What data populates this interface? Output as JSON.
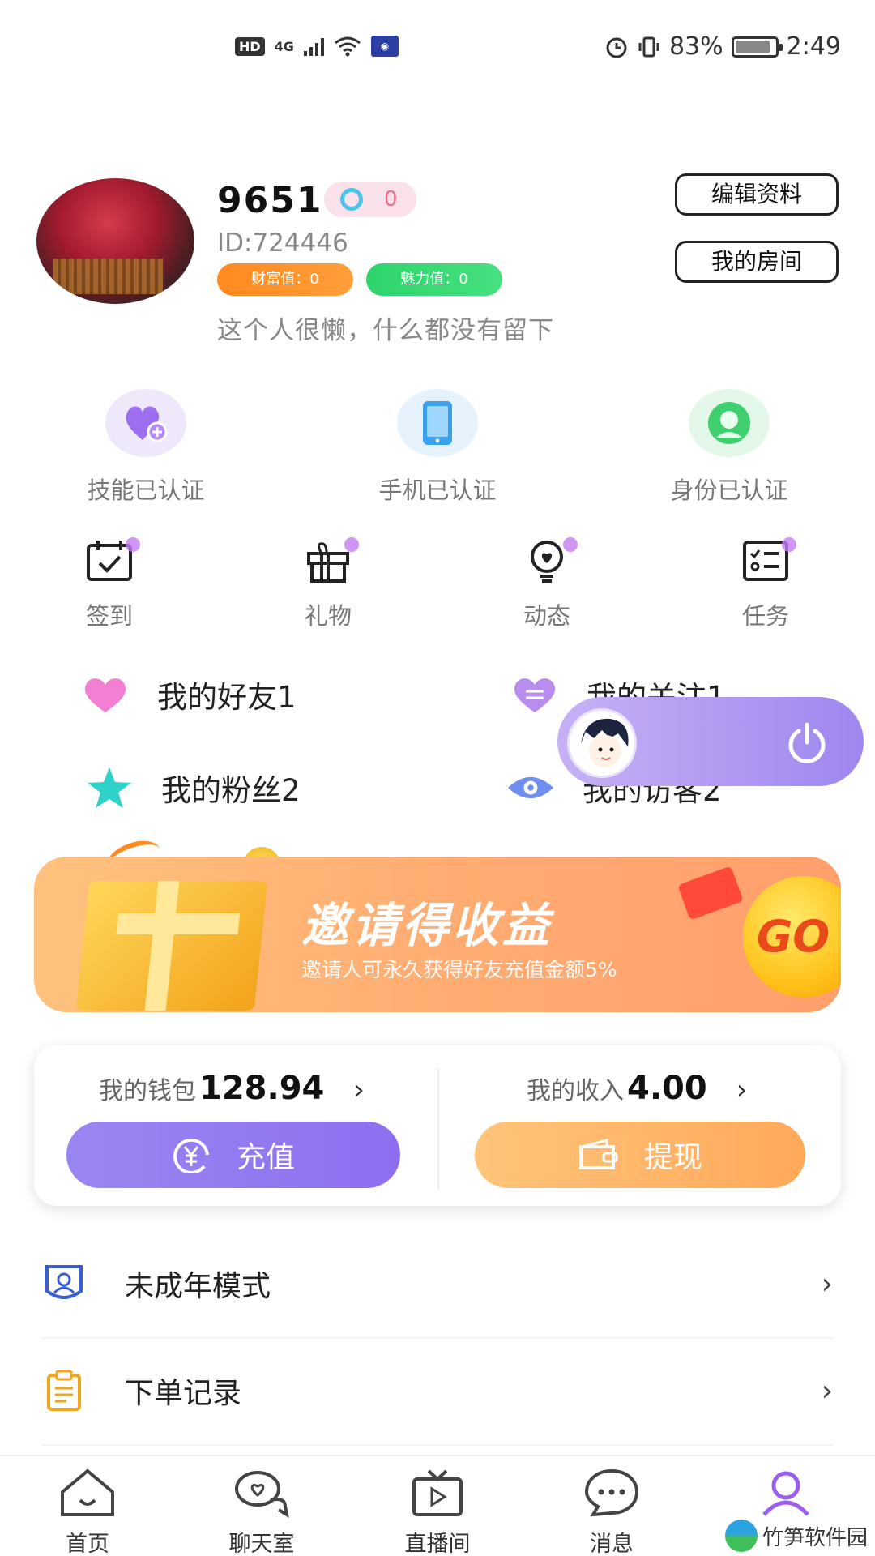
{
  "status_bar": {
    "hd": "HD",
    "signal": "4G",
    "battery_percent": "83%",
    "time": "2:49"
  },
  "profile": {
    "nickname": "9651",
    "gender_count": "0",
    "user_id": "ID:724446",
    "wealth": "财富值：0",
    "charm": "魅力值：0",
    "bio": "这个人很懒，什么都没有留下",
    "edit_button": "编辑资料",
    "room_button": "我的房间"
  },
  "verifications": [
    {
      "label": "技能已认证",
      "icon": "heart-plus-icon"
    },
    {
      "label": "手机已认证",
      "icon": "phone-icon"
    },
    {
      "label": "身份已认证",
      "icon": "person-icon"
    }
  ],
  "quick_actions": [
    {
      "label": "签到",
      "icon": "calendar-check-icon"
    },
    {
      "label": "礼物",
      "icon": "gift-icon"
    },
    {
      "label": "动态",
      "icon": "heart-bulb-icon"
    },
    {
      "label": "任务",
      "icon": "task-list-icon"
    }
  ],
  "social": {
    "friends": "我的好友1",
    "follows": "我的关注1",
    "fans": "我的粉丝2",
    "visitors": "我的访客2"
  },
  "banner": {
    "title": "邀请得收益",
    "subtitle": "邀请人可永久获得好友充值金额5%",
    "go_label": "GO"
  },
  "wallet": {
    "wallet_label": "我的钱包",
    "wallet_amount": "128.94",
    "income_label": "我的收入",
    "income_amount": "4.00",
    "recharge_label": "充值",
    "withdraw_label": "提现"
  },
  "menu": [
    {
      "label": "未成年模式",
      "icon": "shield-user-icon"
    },
    {
      "label": "下单记录",
      "icon": "clipboard-icon"
    }
  ],
  "tabbar": [
    {
      "label": "首页",
      "icon": "home-icon"
    },
    {
      "label": "聊天室",
      "icon": "chat-icon"
    },
    {
      "label": "直播间",
      "icon": "tv-icon"
    },
    {
      "label": "消息",
      "icon": "message-icon"
    },
    {
      "label": "",
      "icon": "user-icon"
    }
  ],
  "watermark": "竹笋软件园",
  "colors": {
    "accent_purple": "#8d6ef0",
    "accent_orange": "#ffa95a",
    "wealth_orange": "#ff8a1f",
    "charm_green": "#2fd46b"
  }
}
